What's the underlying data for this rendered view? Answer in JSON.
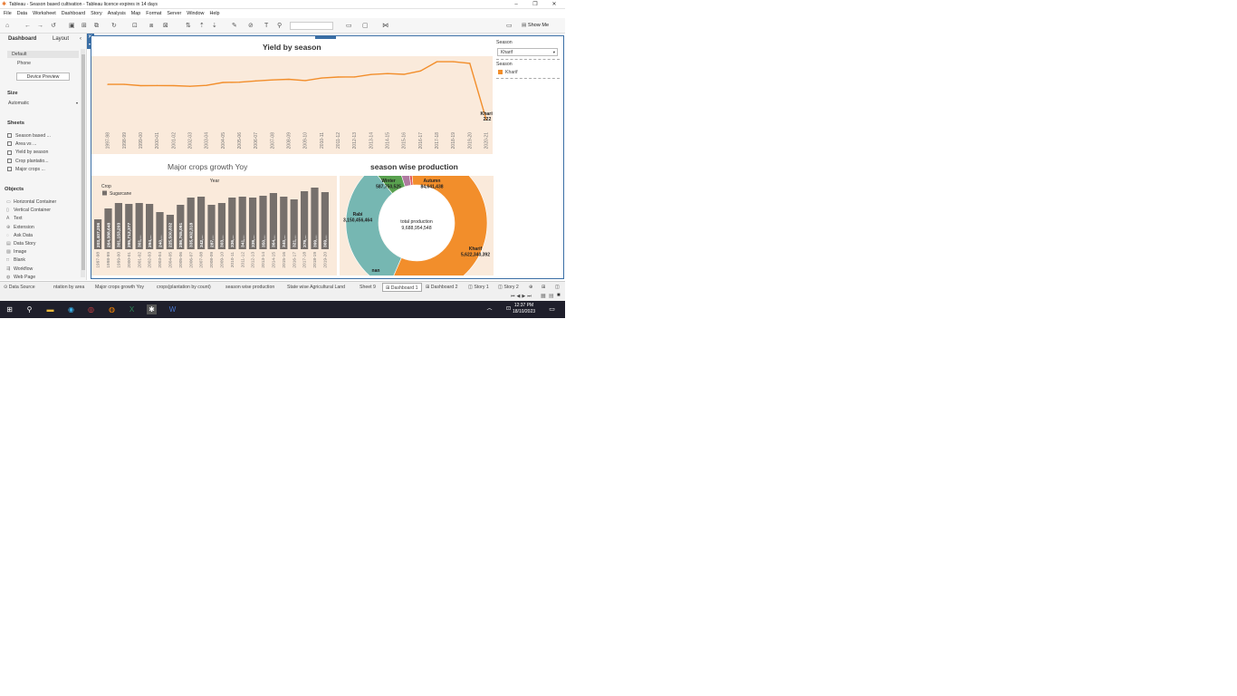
{
  "window": {
    "title": "Tableau - Season based cultivation - Tableau licence expires in 14 days"
  },
  "menu": [
    "File",
    "Data",
    "Worksheet",
    "Dashboard",
    "Story",
    "Analysis",
    "Map",
    "Format",
    "Server",
    "Window",
    "Help"
  ],
  "toolbar": {
    "show_me": "Show Me"
  },
  "left_pane": {
    "tabs": {
      "dashboard": "Dashboard",
      "layout": "Layout"
    },
    "devices": {
      "default": "Default",
      "phone": "Phone",
      "device_preview": "Device Preview"
    },
    "size": {
      "heading": "Size",
      "value": "Automatic"
    },
    "sheets": {
      "heading": "Sheets",
      "items": [
        "Season based ...",
        "Area vs ...",
        "Yield by season",
        "Crop plantatio...",
        "Major crops ..."
      ]
    },
    "objects": {
      "heading": "Objects",
      "items": [
        "Horizontal Container",
        "Vertical Container",
        "Text",
        "Extension",
        "Ask Data",
        "Data Story",
        "Image",
        "Blank",
        "Workflow",
        "Web Page"
      ]
    }
  },
  "right_pane": {
    "filter": {
      "label": "Season",
      "value": "Kharif"
    },
    "legend": {
      "label": "Season",
      "item": "Kharif",
      "color": "#f28e2b"
    }
  },
  "titles": {
    "yield": "Yield by season",
    "crops": "Major crops growth Yoy",
    "season": "season wise production"
  },
  "chart_data": [
    {
      "type": "line",
      "title": "Yield by season",
      "x": [
        "1997-98",
        "1998-99",
        "1999-00",
        "2000-01",
        "2001-02",
        "2002-03",
        "2003-04",
        "2004-05",
        "2005-06",
        "2006-07",
        "2007-08",
        "2008-09",
        "2009-10",
        "2010-11",
        "2011-12",
        "2012-13",
        "2013-14",
        "2014-15",
        "2015-16",
        "2016-17",
        "2017-18",
        "2018-19",
        "2019-20",
        "2020-21"
      ],
      "series": [
        {
          "values": [
            1330,
            1330,
            1290,
            1295,
            1290,
            1270,
            1300,
            1390,
            1400,
            1440,
            1470,
            1490,
            1450,
            1530,
            1560,
            1565,
            1640,
            1670,
            1645,
            1750,
            2040,
            2040,
            1990,
            222
          ]
        }
      ],
      "end_label": {
        "name": "Kharif",
        "value": "222"
      },
      "color": "#f28e2b"
    },
    {
      "type": "bar",
      "title": "Major crops growth Yoy",
      "xlabel": "Year",
      "legend": {
        "title": "Crop",
        "items": [
          "Sugarcane"
        ]
      },
      "categories": [
        "1997-98",
        "1998-99",
        "1999-00",
        "2000-01",
        "2001-02",
        "2002-03",
        "2003-04",
        "2004-05",
        "2005-06",
        "2006-07",
        "2007-08",
        "2008-09",
        "2009-10",
        "2010-11",
        "2011-12",
        "2012-13",
        "2013-14",
        "2014-15",
        "2015-16",
        "2016-17",
        "2017-18",
        "2018-19",
        "2019-20"
      ],
      "values": [
        203407206,
        264388648,
        301153203,
        295,
        301,
        294,
        240,
        225500832,
        286765091,
        335402318,
        342,
        287,
        303,
        336,
        341,
        339,
        350,
        364,
        340,
        321,
        379,
        399,
        369
      ],
      "labels": [
        "203,407,206",
        "264,388,648",
        "301,153,203",
        "295,712,377",
        "301,...",
        "294,...",
        "240,...",
        "225,500,832",
        "286,765,091",
        "335,402,318",
        "342,...",
        "287,...",
        "303,...",
        "336,...",
        "341,...",
        "339,...",
        "350,...",
        "364,...",
        "340,...",
        "321,...",
        "379,...",
        "399,...",
        "369,..."
      ],
      "color": "#76706c"
    },
    {
      "type": "pie",
      "title": "season wise production",
      "center_label": {
        "title": "total production",
        "value": "9,688,954,548"
      },
      "slices": [
        {
          "name": "Kharif",
          "value": 5622340392,
          "label": "5,622,340,392",
          "color": "#f28e2b"
        },
        {
          "name": "Rabi",
          "value": 3150456464,
          "label": "3,150,456,464",
          "color": "#76b7b2"
        },
        {
          "name": "Winter",
          "value": 587750525,
          "label": "587,750,525",
          "color": "#59a14f"
        },
        {
          "name": "Autumn",
          "value": 84641438,
          "label": "84,641,438",
          "color": "#e15759"
        },
        {
          "name": "nan",
          "value": 243765729,
          "label": "",
          "color": "#b07aa1"
        }
      ]
    }
  ],
  "tabs": [
    "Data Source",
    "ntation by area",
    "Major crops growth Yoy",
    "crops(plantation by count)",
    "season wise production",
    "State wise Agricultural Land",
    "Sheet 9",
    "Dashboard 1",
    "Dashboard 2",
    "Story 1",
    "Story 2"
  ],
  "taskbar": {
    "time": "12:37 PM",
    "date": "18/10/2023"
  }
}
